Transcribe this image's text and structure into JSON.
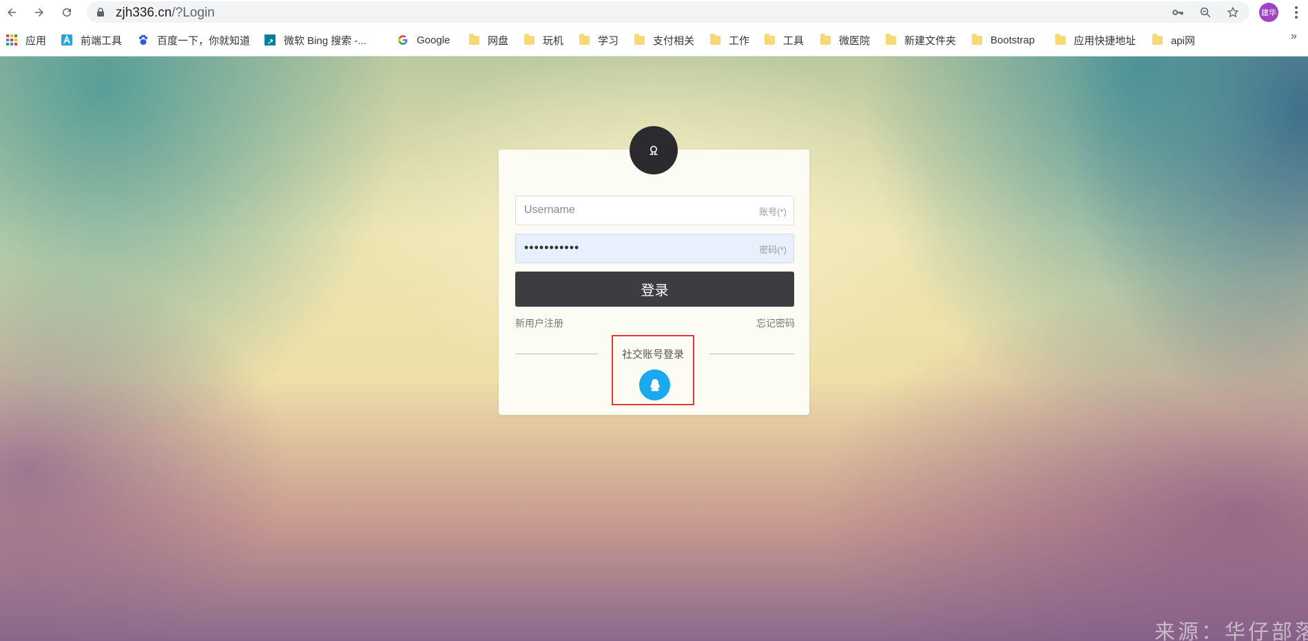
{
  "browser": {
    "url_host": "zjh336.cn",
    "url_path": "/?Login",
    "profile_initials": "建华",
    "colors": {
      "profile": "#a142c4"
    }
  },
  "bookmarks": [
    {
      "label": "应用",
      "icon": "apps-grid-icon"
    },
    {
      "label": "前端工具",
      "icon": "site-a-icon"
    },
    {
      "label": "百度一下，你就知道",
      "icon": "baidu-paw-icon"
    },
    {
      "label": "微软 Bing 搜索 -...",
      "icon": "bing-icon"
    },
    {
      "label": "Google",
      "icon": "google-icon"
    },
    {
      "label": "网盘",
      "icon": "folder-icon"
    },
    {
      "label": "玩机",
      "icon": "folder-icon"
    },
    {
      "label": "学习",
      "icon": "folder-icon"
    },
    {
      "label": "支付相关",
      "icon": "folder-icon"
    },
    {
      "label": "工作",
      "icon": "folder-icon"
    },
    {
      "label": "工具",
      "icon": "folder-icon"
    },
    {
      "label": "微医院",
      "icon": "folder-icon"
    },
    {
      "label": "新建文件夹",
      "icon": "folder-icon"
    },
    {
      "label": "Bootstrap",
      "icon": "folder-icon"
    },
    {
      "label": "应用快捷地址",
      "icon": "folder-icon"
    },
    {
      "label": "api网",
      "icon": "folder-icon"
    }
  ],
  "bookmarks_more": "»",
  "login": {
    "username_placeholder": "Username",
    "username_hint": "账号(*)",
    "password_value": "•••••••••••",
    "password_hint": "密码(*)",
    "submit_label": "登录",
    "register_link": "新用户注册",
    "forgot_link": "忘记密码",
    "social_title": "社交账号登录",
    "colors": {
      "button": "#3e3c40",
      "qq": "#1aa8ee",
      "highlight": "#e33333"
    }
  },
  "watermark": "来源：华仔部落"
}
